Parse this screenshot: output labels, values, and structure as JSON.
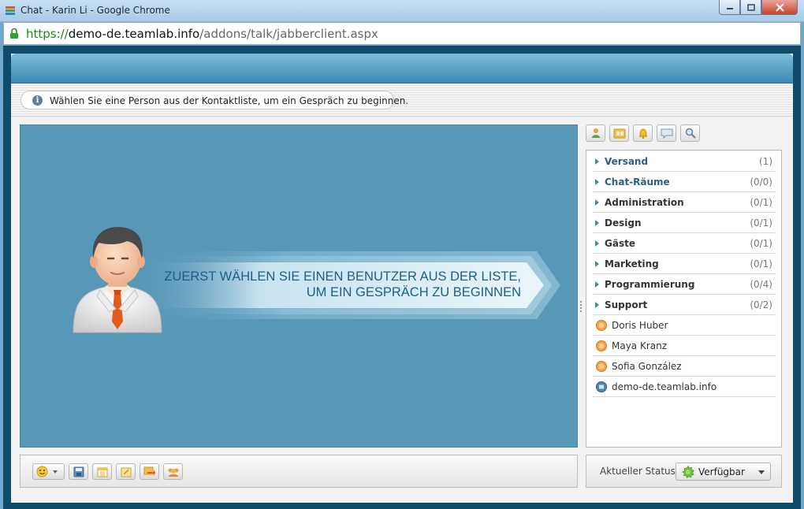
{
  "window": {
    "title": "Chat - Karin Li - Google Chrome"
  },
  "address": {
    "scheme": "https://",
    "host": "demo-de.teamlab.info",
    "path": "/addons/talk/jabberclient.aspx"
  },
  "info": {
    "text": "Wählen Sie eine Person aus der Kontaktliste, um ein Gespräch zu beginnen."
  },
  "stage": {
    "line1": "ZUERST WÄHLEN SIE EINEN BENUTZER AUS DER LISTE,",
    "line2": "UM EIN GESPRÄCH ZU BEGINNEN"
  },
  "toolbar": {
    "icons": [
      "add-contact-icon",
      "group-folder-icon",
      "notification-bell-icon",
      "message-history-icon",
      "search-icon"
    ]
  },
  "contacts": {
    "groups": [
      {
        "name": "Versand",
        "count": "(1)"
      },
      {
        "name": "Chat-Räume",
        "count": "(0/0)"
      },
      {
        "name": "Administration",
        "count": "(0/1)"
      },
      {
        "name": "Design",
        "count": "(0/1)"
      },
      {
        "name": "Gäste",
        "count": "(0/1)"
      },
      {
        "name": "Marketing",
        "count": "(0/1)"
      },
      {
        "name": "Programmierung",
        "count": "(0/4)"
      },
      {
        "name": "Support",
        "count": "(0/2)"
      }
    ],
    "people": [
      {
        "name": "Doris Huber",
        "status": "away"
      },
      {
        "name": "Maya Kranz",
        "status": "away"
      },
      {
        "name": "Sofia González",
        "status": "away"
      },
      {
        "name": "demo-de.teamlab.info",
        "status": "server"
      }
    ]
  },
  "bottom": {
    "icons": [
      "smiley-icon",
      "save-icon",
      "calendar-icon",
      "edit-note-icon",
      "send-file-icon",
      "group-chat-icon"
    ]
  },
  "status": {
    "label": "Aktueller Status:",
    "value": "Verfügbar"
  },
  "colors": {
    "stage": "#5797b7",
    "header_top": "#7fbddc",
    "header_bottom": "#3b89b4",
    "banner_text": "#1c5f86",
    "tie": "#e25a1c"
  }
}
